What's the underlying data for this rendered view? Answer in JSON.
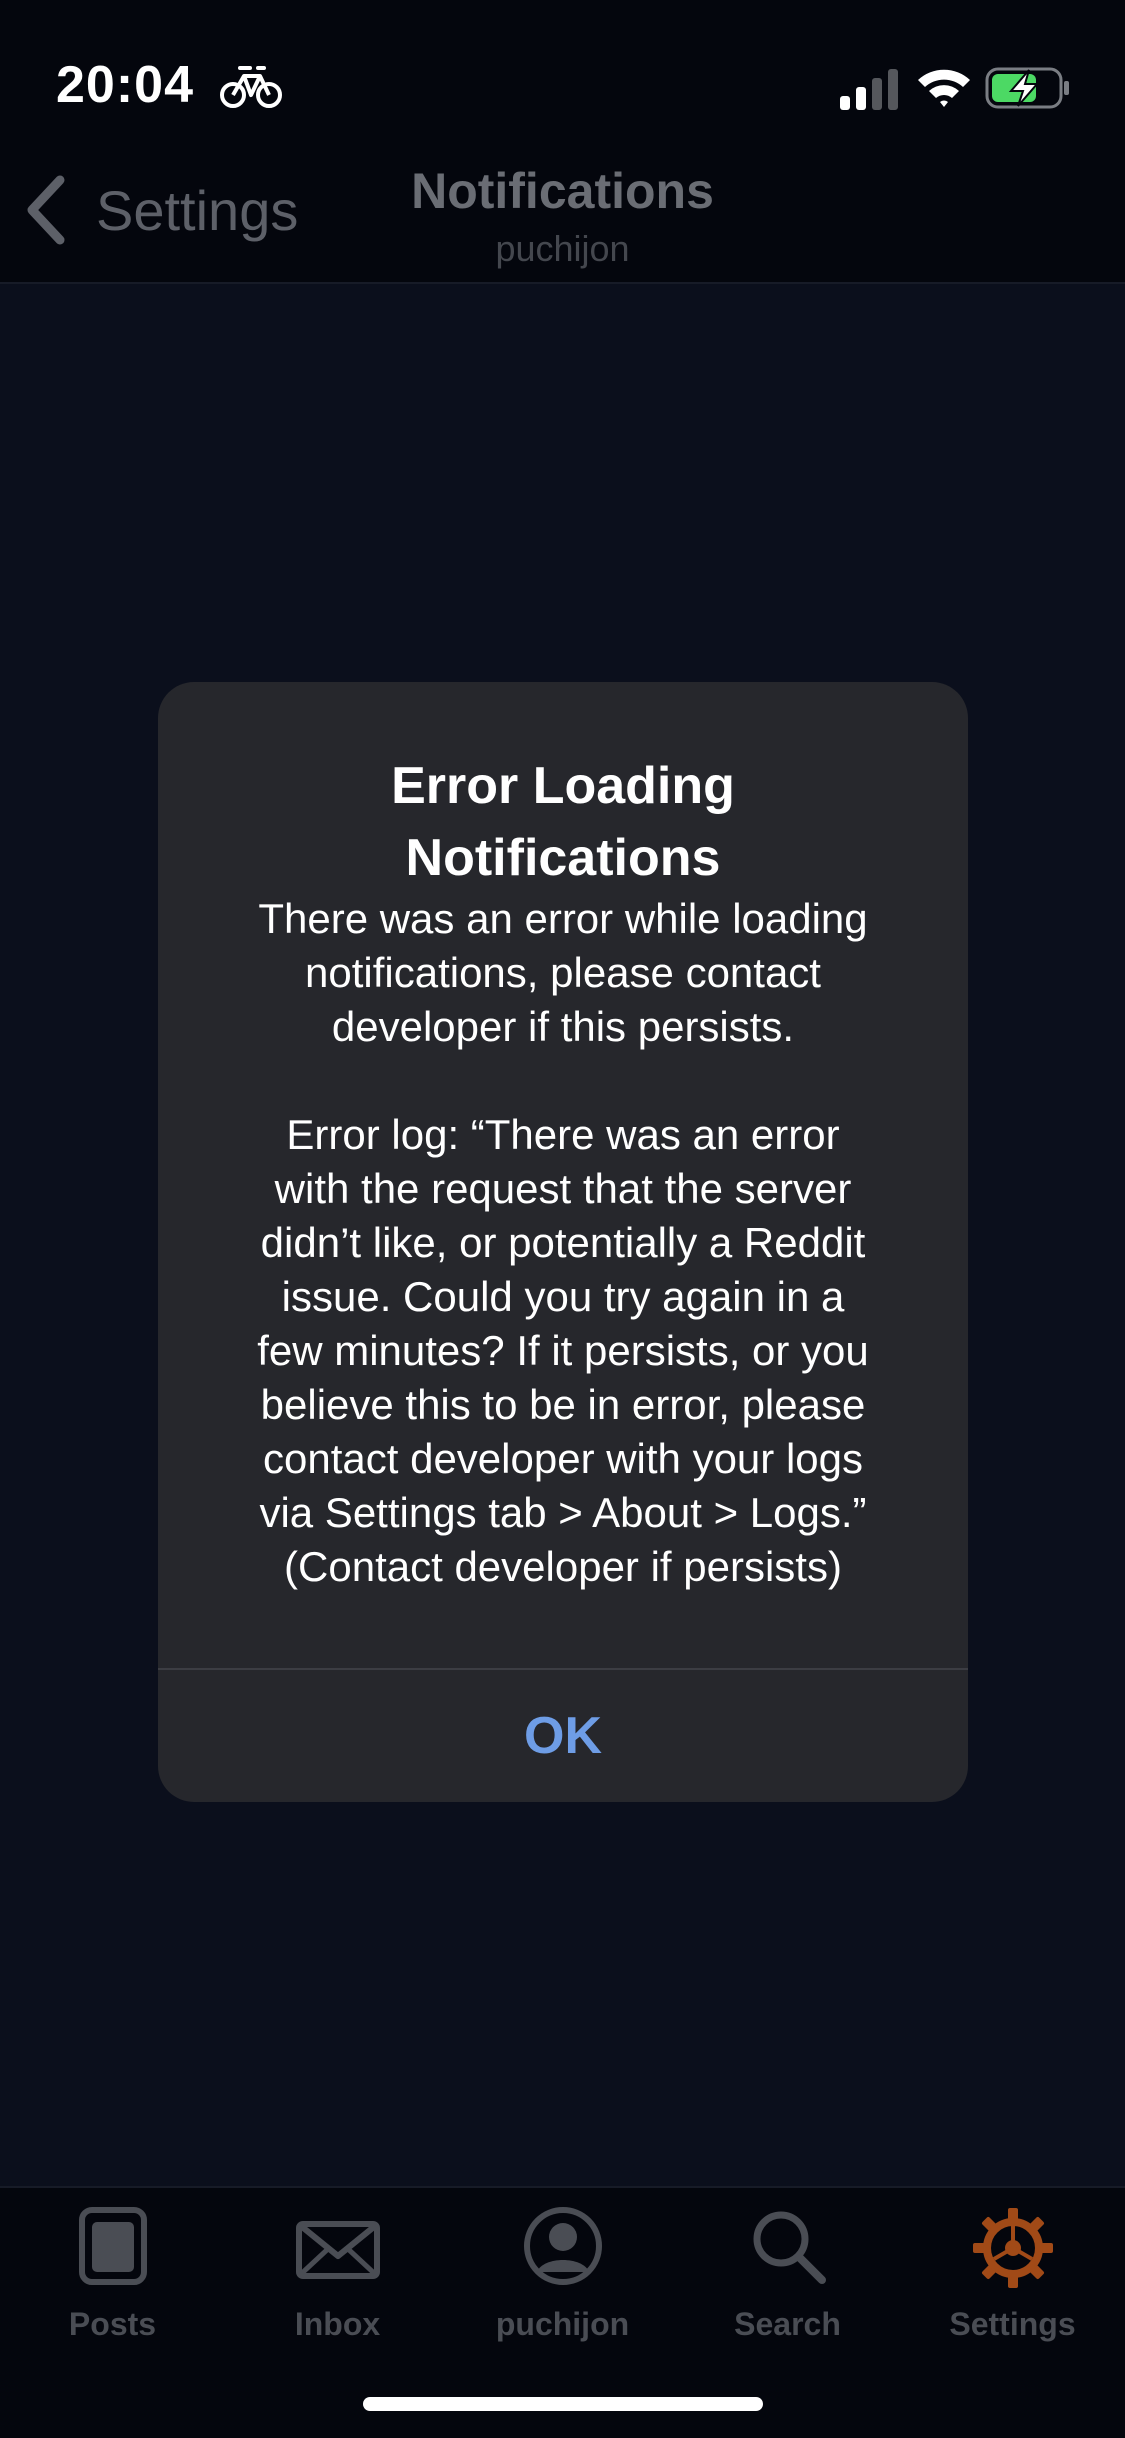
{
  "status_bar": {
    "time": "20:04",
    "icons": [
      "bike-icon",
      "signal-icon",
      "wifi-icon",
      "battery-charging-icon"
    ]
  },
  "nav": {
    "back_label": "Settings",
    "title": "Notifications",
    "subtitle": "puchijon"
  },
  "alert": {
    "title_line1": "Error Loading",
    "title_line2": "Notifications",
    "message_lines": [
      "There was an error while loading",
      "notifications, please contact",
      "developer if this persists."
    ],
    "log_lines": [
      "Error log: “There was an error",
      "with the request that the server",
      "didn’t like, or potentially a Reddit",
      "issue. Could you try again in a",
      "few minutes? If it persists, or you",
      "believe this to be in error, please",
      "contact developer with your logs",
      "via Settings tab > About > Logs.”",
      "(Contact developer if persists)"
    ],
    "ok_label": "OK"
  },
  "tabs": [
    {
      "label": "Posts",
      "icon": "posts-icon"
    },
    {
      "label": "Inbox",
      "icon": "inbox-icon"
    },
    {
      "label": "puchijon",
      "icon": "profile-icon"
    },
    {
      "label": "Search",
      "icon": "search-icon"
    },
    {
      "label": "Settings",
      "icon": "settings-gear-icon",
      "active": true
    }
  ],
  "colors": {
    "background": "#0b0f1c",
    "alert_background": "#26272c",
    "ok_button": "#6e9de6",
    "active_tab_icon": "#a14a17",
    "battery_fill": "#4cd964"
  }
}
